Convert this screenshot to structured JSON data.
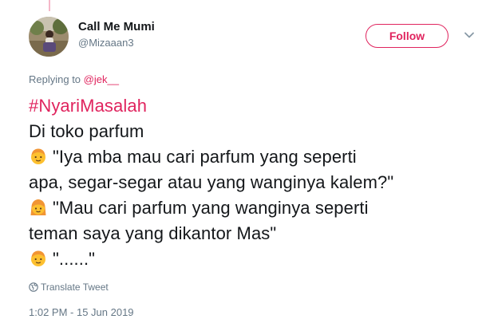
{
  "author": {
    "display_name": "Call Me Mumi",
    "handle": "@Mizaaan3"
  },
  "follow_label": "Follow",
  "reply": {
    "prefix": "Replying to ",
    "mention": "@jek__"
  },
  "tweet": {
    "hashtag": "#NyariMasalah",
    "line2": "Di toko parfum",
    "line3": "\"Iya mba mau cari parfum yang seperti",
    "line4": "apa, segar-segar atau yang wanginya kalem?\"",
    "line5": "\"Mau cari parfum yang wanginya seperti",
    "line6": "teman saya yang dikantor Mas\"",
    "line7": "\"......\"",
    "emoji_1": "boy-emoji",
    "emoji_2": "girl-emoji",
    "emoji_3": "boy-emoji"
  },
  "translate_label": "Translate Tweet",
  "timestamp": "1:02 PM - 15 Jun 2019",
  "colors": {
    "accent": "#e0245e",
    "secondary_text": "#657786",
    "primary_text": "#14171a"
  }
}
